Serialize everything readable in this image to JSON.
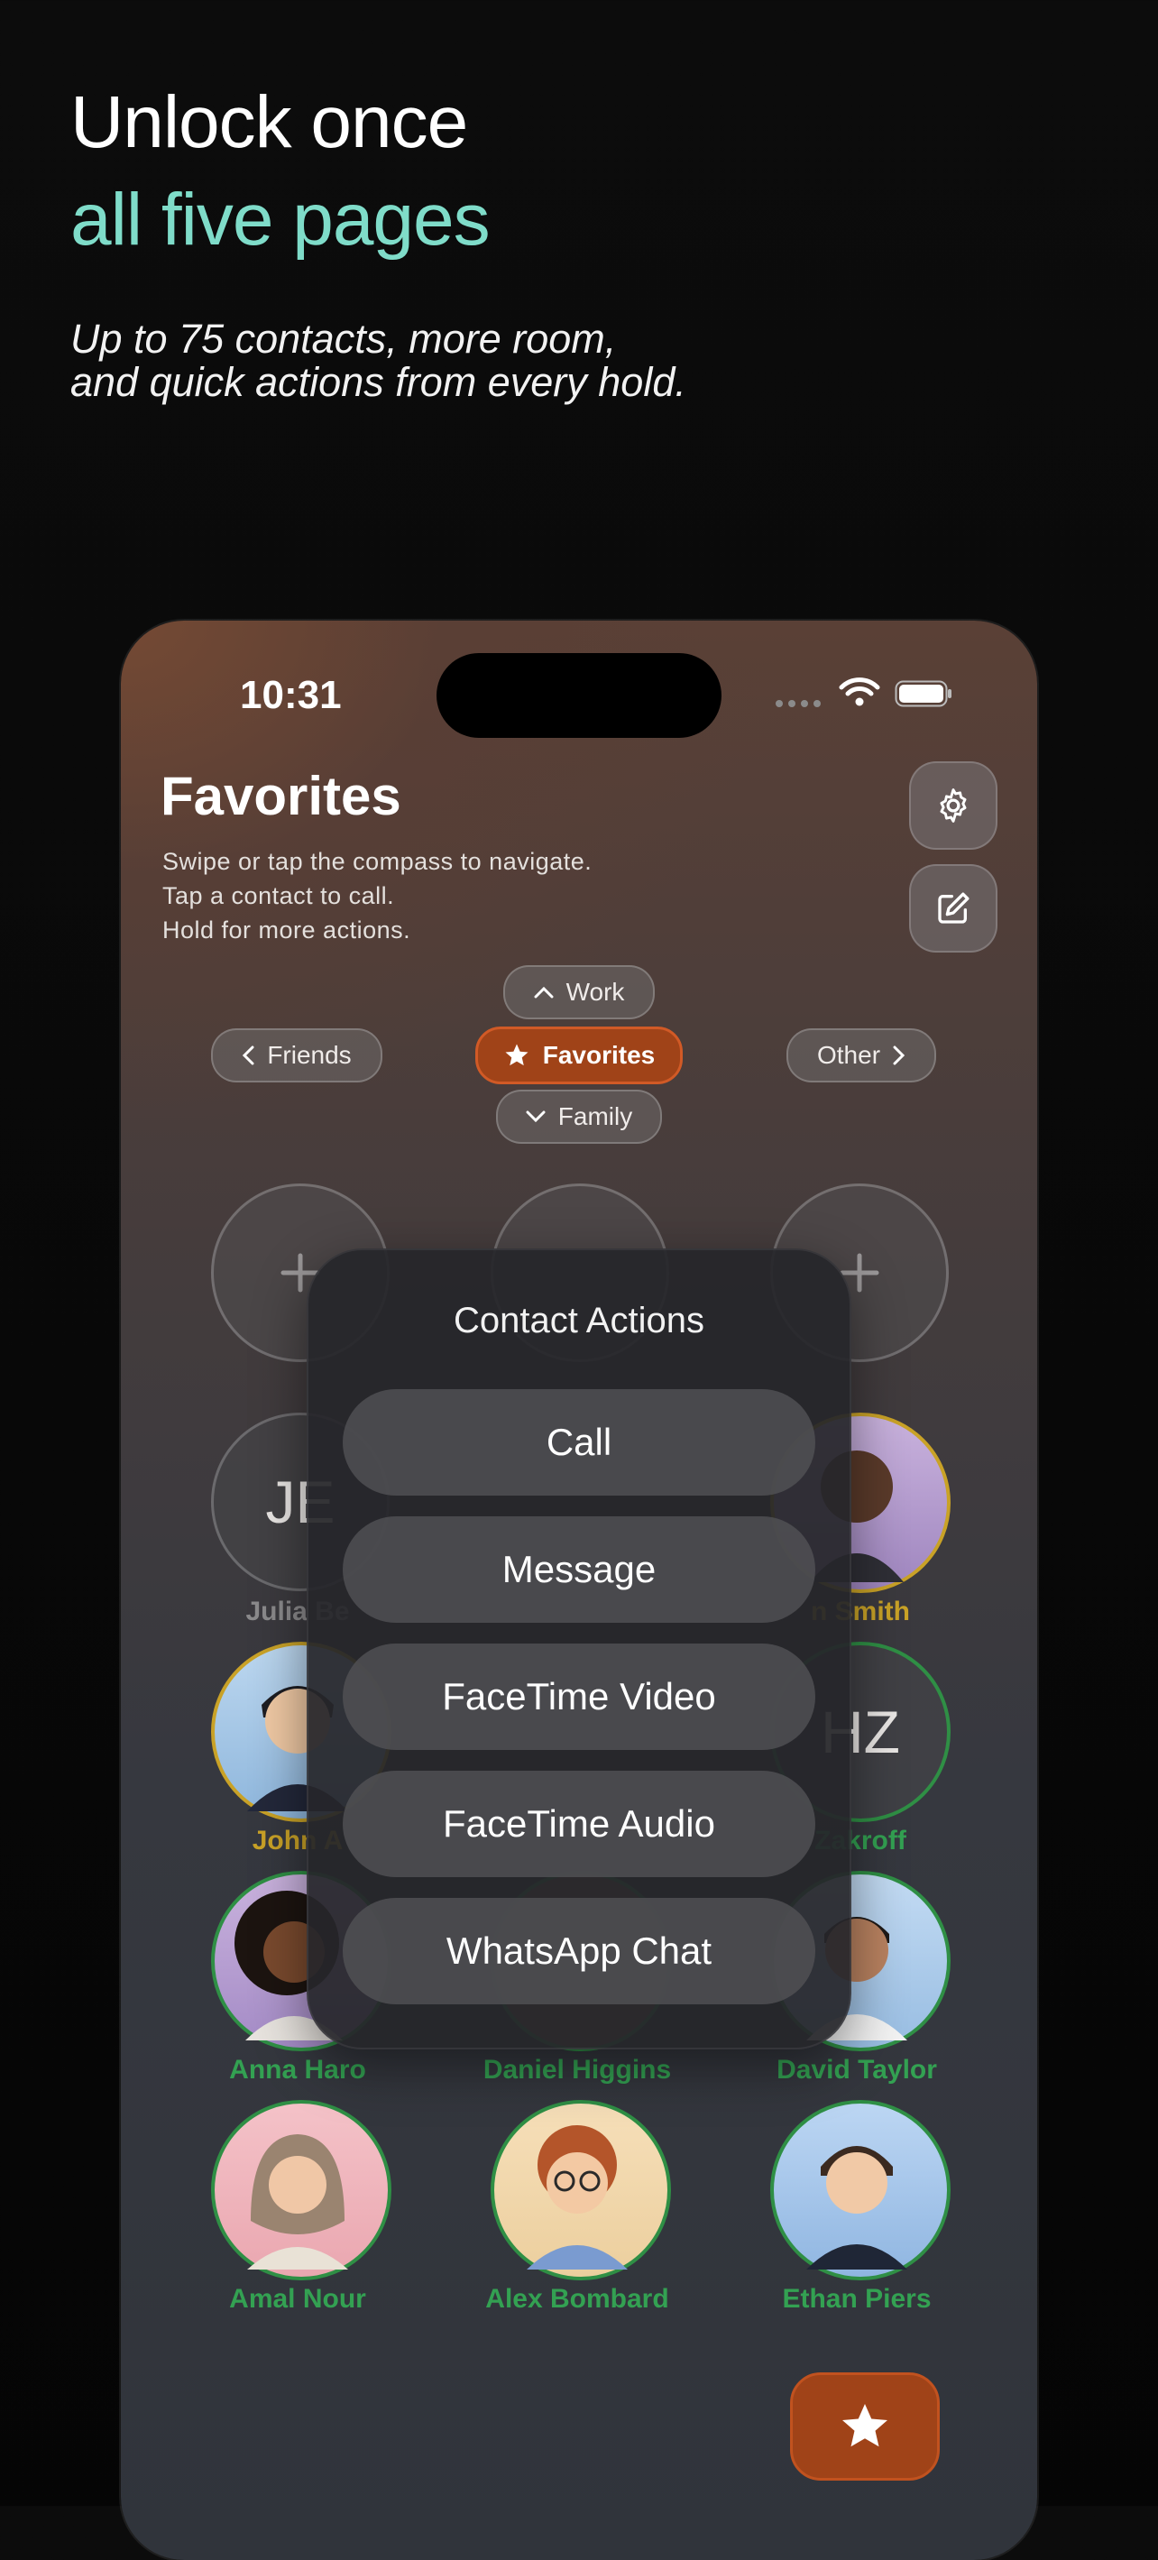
{
  "headline": {
    "line1": "Unlock once",
    "line2": "all five pages"
  },
  "subtitle": {
    "line1": "Up to 75 contacts, more room,",
    "line2": "and quick actions from every hold."
  },
  "status_bar": {
    "time": "10:31"
  },
  "page": {
    "title": "Favorites",
    "instructions": [
      "Swipe or tap the compass to navigate.",
      "Tap a contact to call.",
      "Hold for more actions."
    ]
  },
  "compass": {
    "up": "Work",
    "left": "Friends",
    "center": "Favorites",
    "down": "Family",
    "right": "Other"
  },
  "contacts": {
    "row2": {
      "left_initials": "JE",
      "left_name": "Julia Be",
      "right_name": "n Smith"
    },
    "row3": {
      "left_name": "John A",
      "right_initials": "HZ",
      "right_name": "Zakroff"
    },
    "row4": [
      "Anna Haro",
      "Daniel Higgins",
      "David Taylor"
    ],
    "row5": [
      "Amal Nour",
      "Alex Bombard",
      "Ethan Piers"
    ]
  },
  "menu": {
    "title": "Contact Actions",
    "actions": [
      "Call",
      "Message",
      "FaceTime Video",
      "FaceTime Audio",
      "WhatsApp Chat"
    ]
  },
  "colors": {
    "accent_teal": "#7fdcc9",
    "accent_orange": "#a04318",
    "ring_gold": "#c9a227",
    "ring_green": "#2f8f45"
  }
}
